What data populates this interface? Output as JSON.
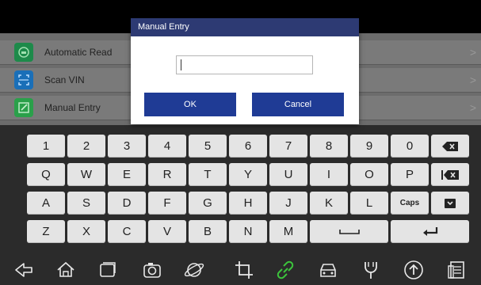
{
  "menu": {
    "items": [
      {
        "label": "Automatic Read",
        "icon": "car-scan-icon",
        "color": "#1d8a4a"
      },
      {
        "label": "Scan VIN",
        "icon": "scan-frame-icon",
        "color": "#1a6fb8"
      },
      {
        "label": "Manual Entry",
        "icon": "edit-icon",
        "color": "#2aa04a"
      }
    ],
    "chevron": ">"
  },
  "dialog": {
    "title": "Manual Entry",
    "input_value": "",
    "ok_label": "OK",
    "cancel_label": "Cancel"
  },
  "keyboard": {
    "rows": [
      [
        "1",
        "2",
        "3",
        "4",
        "5",
        "6",
        "7",
        "8",
        "9",
        "0"
      ],
      [
        "Q",
        "W",
        "E",
        "R",
        "T",
        "Y",
        "U",
        "I",
        "O",
        "P"
      ],
      [
        "A",
        "S",
        "D",
        "F",
        "G",
        "H",
        "J",
        "K",
        "L",
        "Caps"
      ],
      [
        "Z",
        "X",
        "C",
        "V",
        "B",
        "N",
        "M"
      ]
    ]
  },
  "navbar": {
    "icons": [
      "back-icon",
      "home-icon",
      "recent-apps-icon",
      "camera-icon",
      "browser-icon",
      "crop-icon",
      "link-icon",
      "car-icon",
      "tools-icon",
      "upload-icon",
      "report-icon"
    ]
  }
}
